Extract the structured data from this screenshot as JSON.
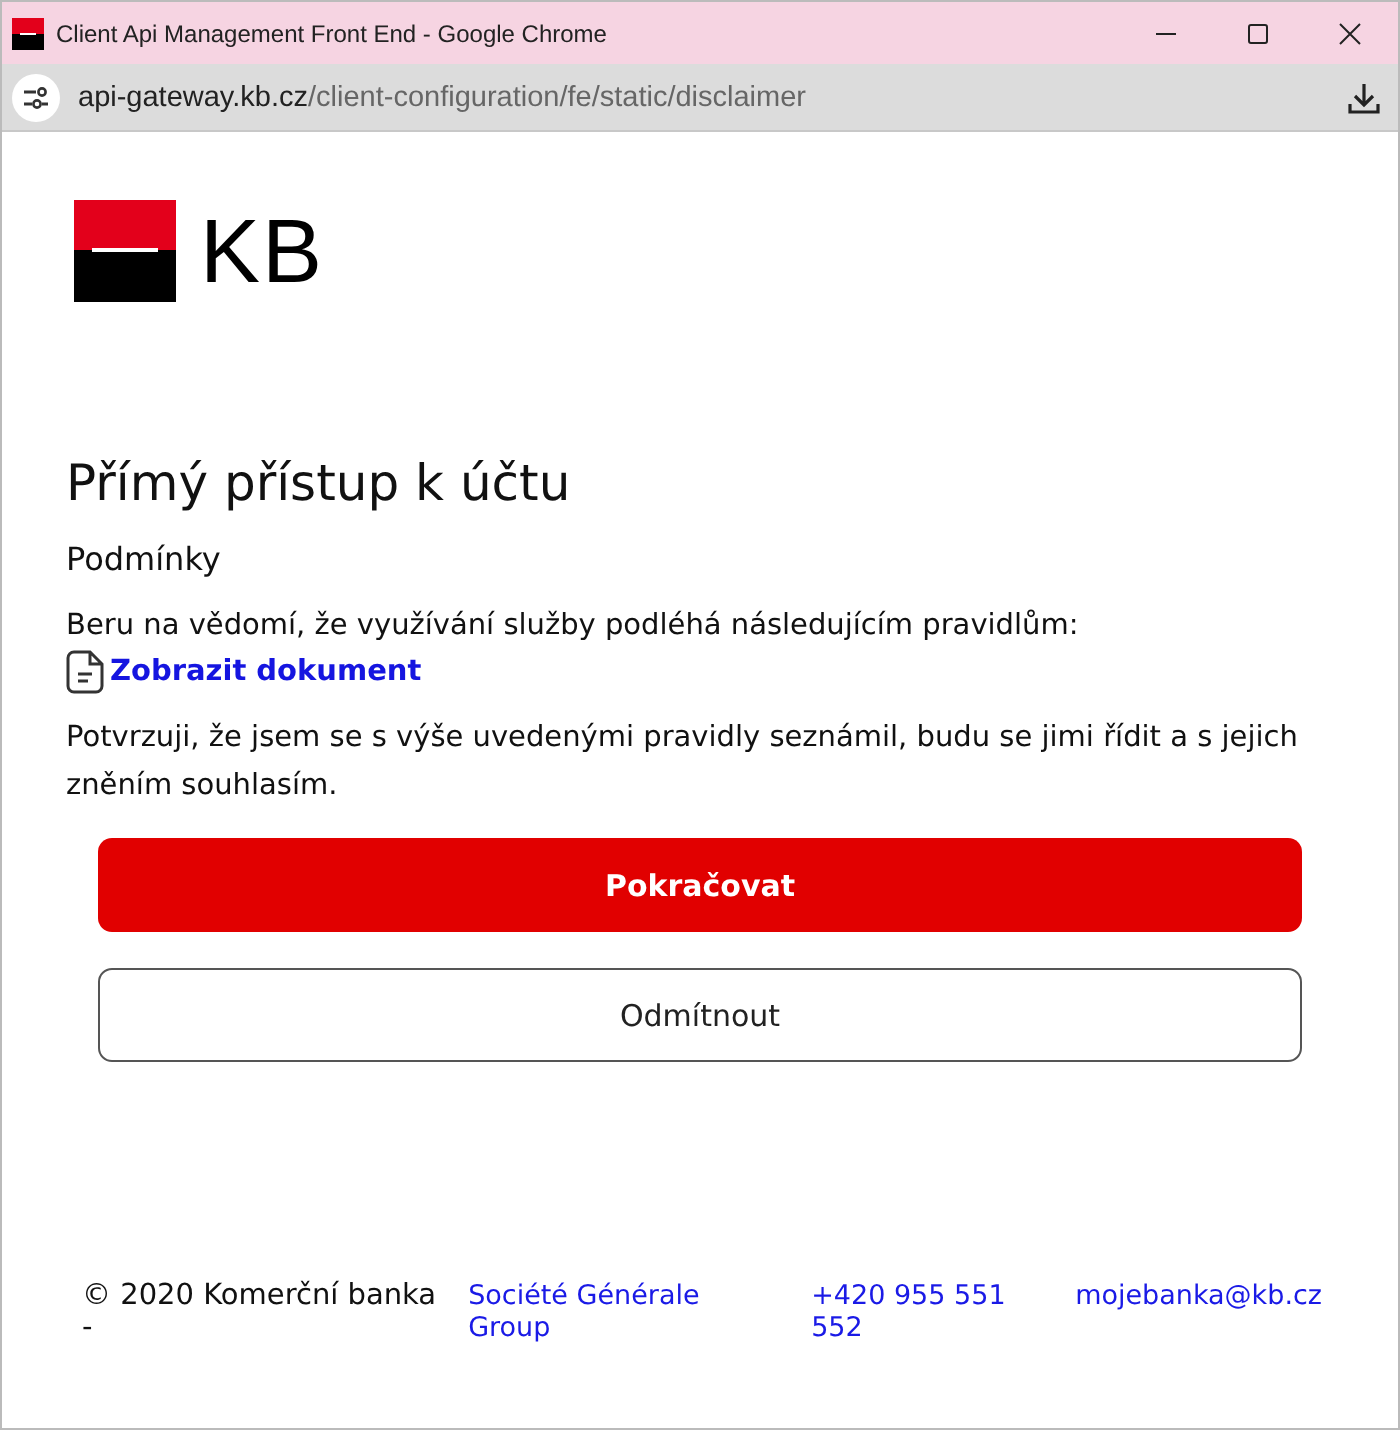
{
  "window": {
    "title": "Client Api Management Front End - Google Chrome"
  },
  "address_bar": {
    "domain": "api-gateway.kb.cz",
    "path": "/client-configuration/fe/static/disclaimer"
  },
  "logo": {
    "text": "KB"
  },
  "heading": "Přímý přístup k účtu",
  "subheading": "Podmínky",
  "intro": "Beru na vědomí, že využívání služby podléhá následujícím pravidlům:",
  "document_link": "Zobrazit dokument",
  "confirmation": "Potvrzuji, že jsem se s výše uvedenými pravidly seznámil, budu se jimi řídit a s jejich zněním souhlasím.",
  "buttons": [
    {
      "label": "Pokračovat",
      "kind": "primary"
    },
    {
      "label": "Odmítnout",
      "kind": "secondary"
    }
  ],
  "footer": {
    "copyright": "© 2020 Komerční banka -",
    "group_link": "Société Générale Group",
    "phone": "+420 955 551 552",
    "email": "mojebanka@kb.cz"
  }
}
